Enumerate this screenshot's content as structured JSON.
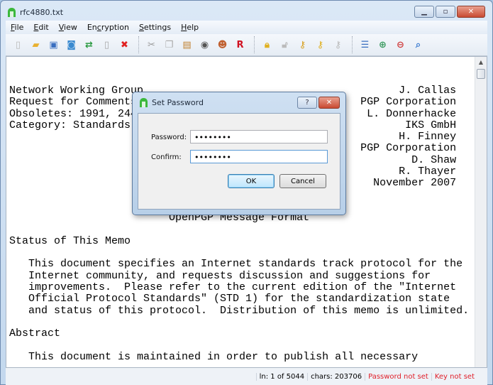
{
  "window": {
    "title": "rfc4880.txt",
    "controls": [
      "minimize",
      "maximize",
      "close"
    ]
  },
  "menu": [
    {
      "label": "File",
      "u": "F",
      "rest": "ile"
    },
    {
      "label": "Edit",
      "u": "E",
      "rest": "dit"
    },
    {
      "label": "View",
      "u": "V",
      "rest": "iew"
    },
    {
      "label": "Encryption",
      "pre": "En",
      "u": "c",
      "rest": "ryption"
    },
    {
      "label": "Settings",
      "u": "S",
      "rest": "ettings"
    },
    {
      "label": "Help",
      "u": "H",
      "rest": "elp"
    }
  ],
  "toolbar": [
    [
      "new-file",
      "open-folder",
      "save",
      "save-all",
      "convert",
      "print-preview",
      "close-file"
    ],
    [
      "cut",
      "copy",
      "paste",
      "find-binoculars",
      "user",
      "r-recipient"
    ],
    [
      "lock",
      "unlock",
      "key-add",
      "key",
      "key-remove"
    ],
    [
      "word-wrap",
      "zoom-in",
      "zoom-out",
      "zoom-reset"
    ]
  ],
  "document": {
    "lines": [
      "Network Working Group                                        J. Callas",
      "Request for Comments: 4880                             PGP Corporation",
      "Obsoletes: 1991, 2440                                   L. Donnerhacke",
      "Category: Standards Track                                     IKS GmbH",
      "                                                             H. Finney",
      "                                                       PGP Corporation",
      "                                                               D. Shaw",
      "                                                             R. Thayer",
      "                                                         November 2007",
      "",
      "",
      "                         OpenPGP Message Format",
      "",
      "Status of This Memo",
      "",
      "   This document specifies an Internet standards track protocol for the",
      "   Internet community, and requests discussion and suggestions for",
      "   improvements.  Please refer to the current edition of the \"Internet",
      "   Official Protocol Standards\" (STD 1) for the standardization state",
      "   and status of this protocol.  Distribution of this memo is unlimited.",
      "",
      "Abstract",
      "",
      "   This document is maintained in order to publish all necessary"
    ]
  },
  "status": {
    "line": "ln: 1 of 5044",
    "chars": "chars: 203706",
    "password": "Password not set",
    "key": "Key not set",
    "alert_color": "#e0202a"
  },
  "dialog": {
    "title": "Set Password",
    "password_label": "Password:",
    "confirm_label": "Confirm:",
    "password_value": "••••••••",
    "confirm_value": "••••••••",
    "ok": "OK",
    "cancel": "Cancel",
    "help": "?",
    "close": "✕"
  }
}
